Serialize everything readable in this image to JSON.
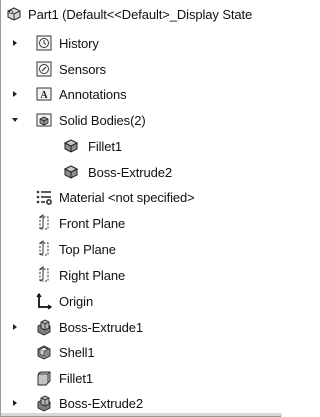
{
  "tree": {
    "part": {
      "label": "Part1  (Default<<Default>_Display State",
      "icon": "part-icon"
    },
    "items": [
      {
        "label": "History",
        "icon": "history-icon",
        "expandable": true
      },
      {
        "label": "Sensors",
        "icon": "sensors-icon",
        "expandable": false
      },
      {
        "label": "Annotations",
        "icon": "annotations-icon",
        "expandable": true
      },
      {
        "label": "Solid Bodies(2)",
        "icon": "solid-bodies-icon",
        "expandable": true,
        "expanded": true
      },
      {
        "label": "Fillet1",
        "icon": "solid-body-icon",
        "expandable": false
      },
      {
        "label": "Boss-Extrude2",
        "icon": "solid-body-icon",
        "expandable": false
      },
      {
        "label": "Material <not specified>",
        "icon": "material-icon",
        "expandable": false
      },
      {
        "label": "Front Plane",
        "icon": "plane-icon",
        "expandable": false
      },
      {
        "label": "Top Plane",
        "icon": "plane-icon",
        "expandable": false
      },
      {
        "label": "Right Plane",
        "icon": "plane-icon",
        "expandable": false
      },
      {
        "label": "Origin",
        "icon": "origin-icon",
        "expandable": false
      },
      {
        "label": "Boss-Extrude1",
        "icon": "boss-extrude-icon",
        "expandable": true
      },
      {
        "label": "Shell1",
        "icon": "shell-icon",
        "expandable": false
      },
      {
        "label": "Fillet1",
        "icon": "fillet-icon",
        "expandable": false
      },
      {
        "label": "Boss-Extrude2",
        "icon": "boss-extrude-icon",
        "expandable": true
      }
    ]
  }
}
